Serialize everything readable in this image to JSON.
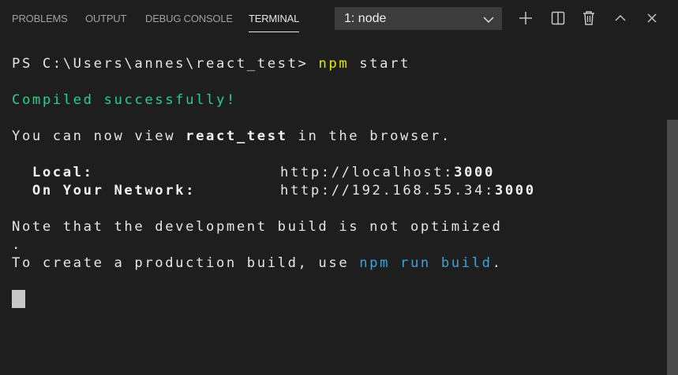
{
  "tabs": [
    {
      "label": "PROBLEMS"
    },
    {
      "label": "OUTPUT"
    },
    {
      "label": "DEBUG CONSOLE"
    },
    {
      "label": "TERMINAL",
      "active": true
    }
  ],
  "terminal_select": {
    "value": "1: node"
  },
  "actions": [
    "plus-icon",
    "split-icon",
    "trash-icon",
    "chevron-up-icon",
    "close-icon"
  ],
  "terminal": {
    "prompt": "PS C:\\Users\\annes\\react_test> ",
    "command_npm": "npm",
    "command_rest": " start",
    "compiled": "Compiled successfully!",
    "view_pre": "You can now view ",
    "view_app": "react_test",
    "view_post": " in the browser.",
    "local_label": "  Local:",
    "local_url_pre": "http://localhost:",
    "local_port": "3000",
    "network_label": "  On Your Network:",
    "network_url_pre": "http://192.168.55.34:",
    "network_port": "3000",
    "note_line1": "Note that the development build is not optimized",
    "note_line2": ".",
    "create_pre": "To create a production build, use ",
    "create_cmd": "npm run build",
    "create_post": "."
  },
  "colors": {
    "background": "#1e1e1e",
    "npm_yellow": "#e5e510",
    "success_green": "#23d18b",
    "command_cyan": "#3aa5d6"
  }
}
